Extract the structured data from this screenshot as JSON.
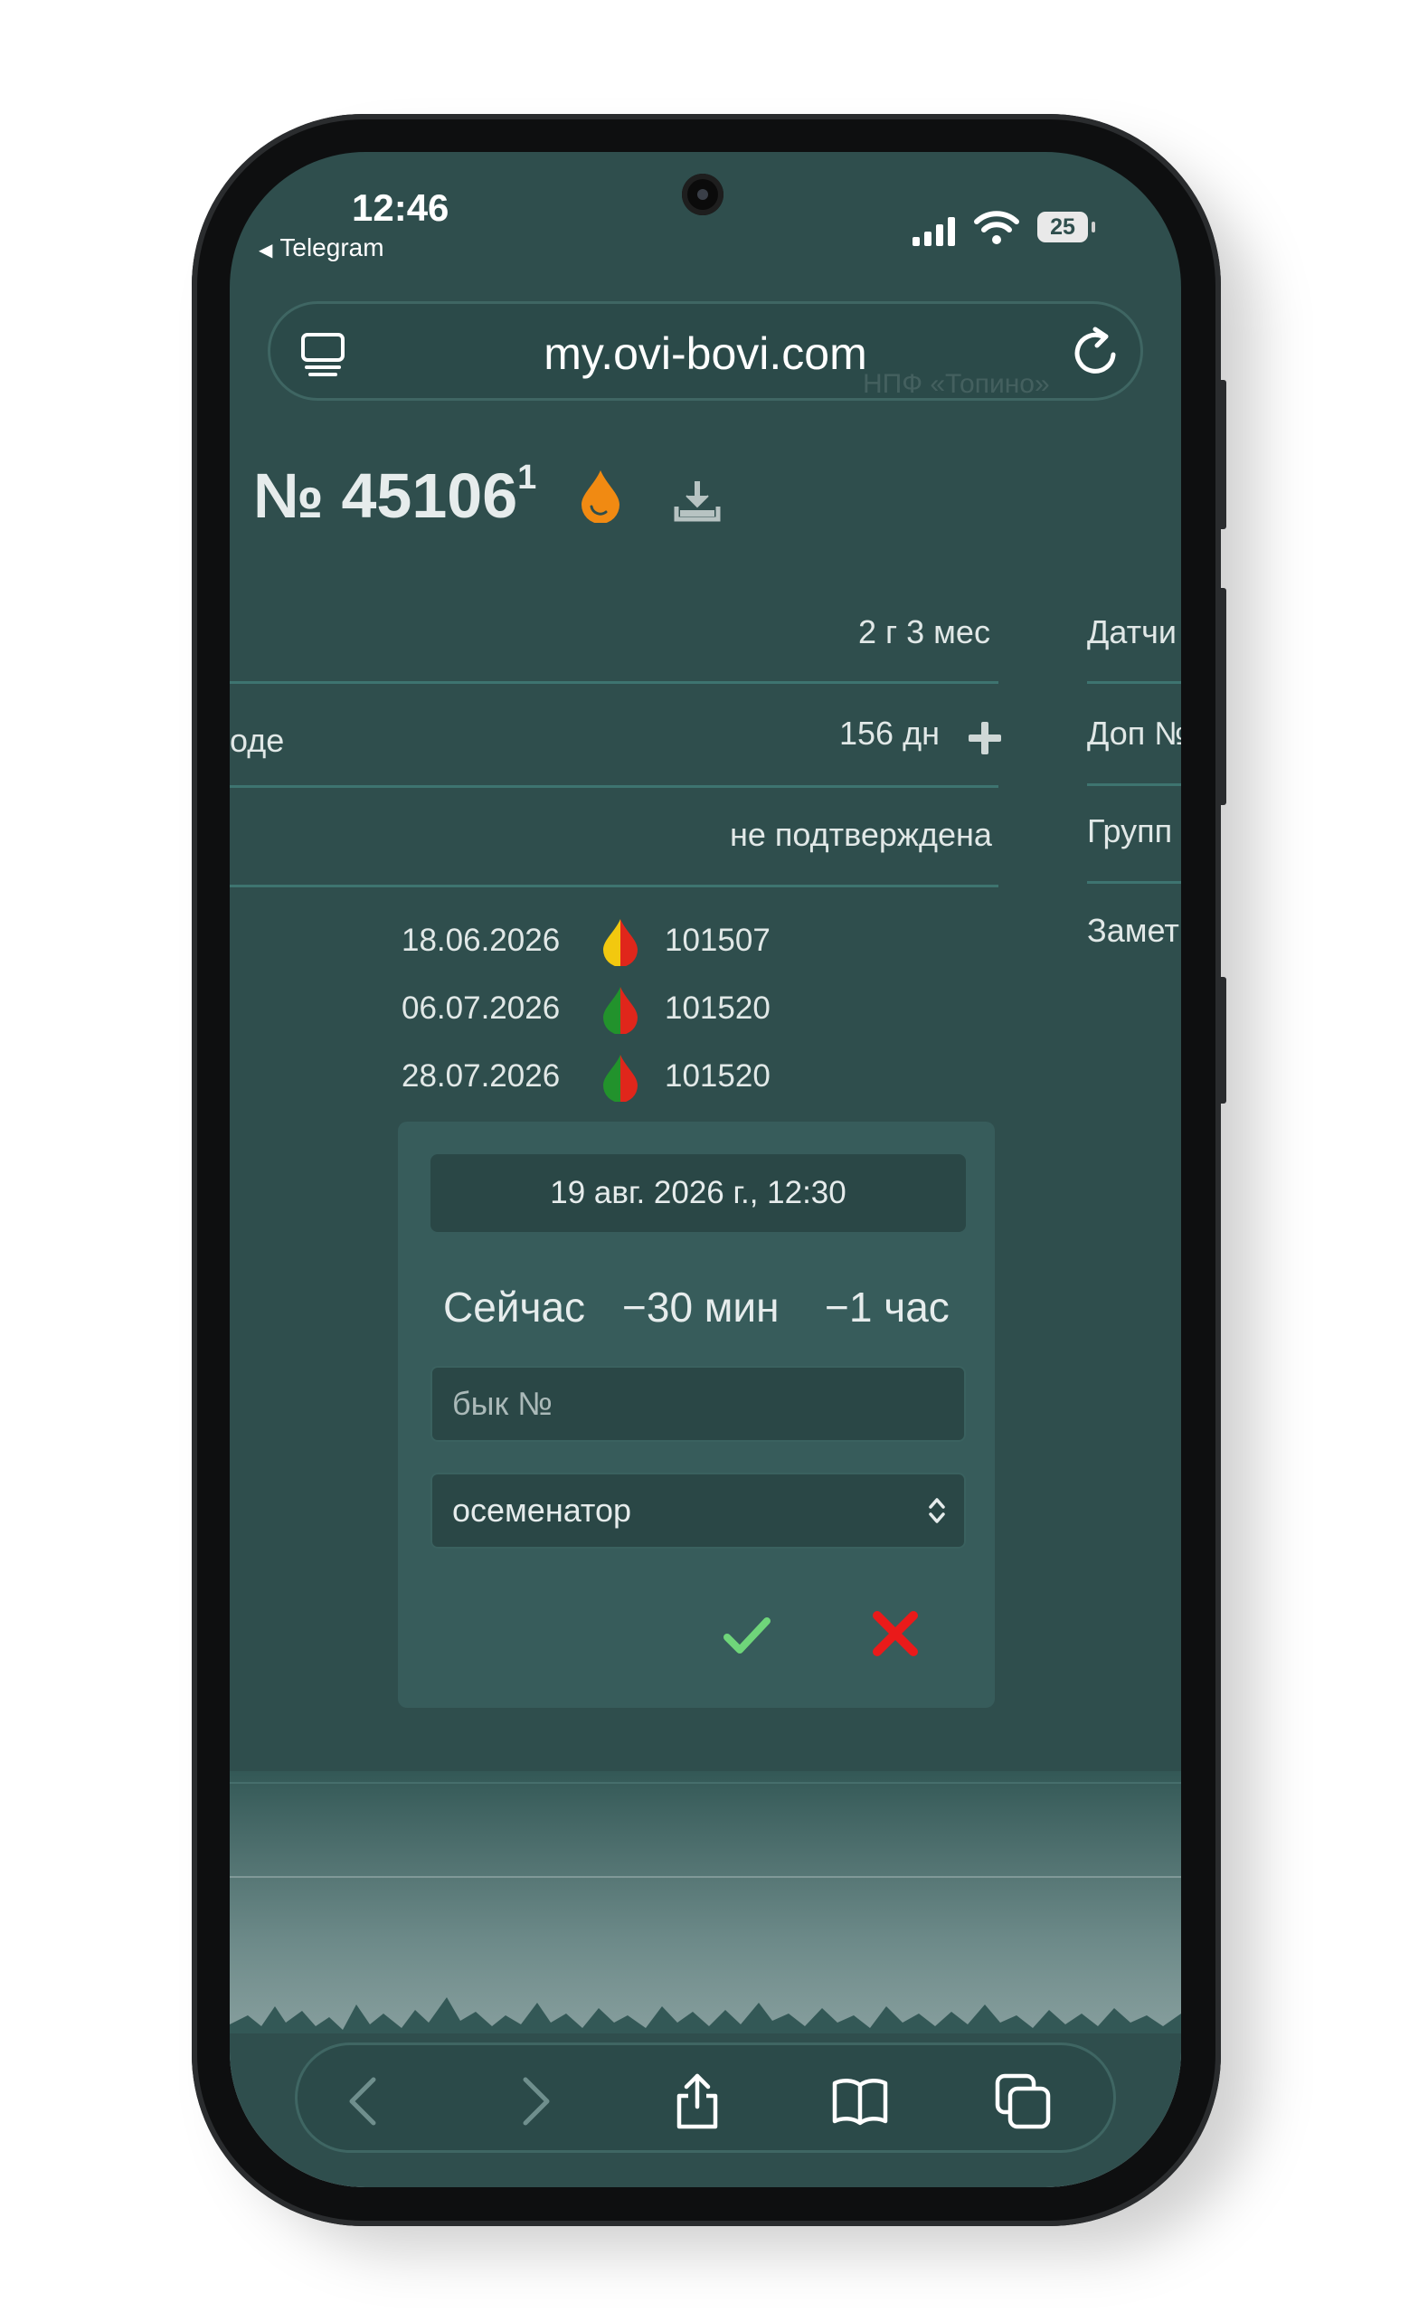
{
  "status": {
    "time": "12:46",
    "back_app": "Telegram",
    "battery": "25"
  },
  "browser": {
    "url": "my.ovi-bovi.com"
  },
  "ghost_text": "НПФ «Топино»",
  "animal": {
    "number": "№ 45106",
    "superscript": "1"
  },
  "info_rows": [
    {
      "left": "",
      "value": "2 г 3 мес"
    },
    {
      "left": "оде",
      "value": "156 дн"
    },
    {
      "left": "",
      "value": "не подтверждена"
    }
  ],
  "side_menu": [
    "Датчи",
    "Доп №",
    "Групп",
    "Замет"
  ],
  "history": [
    {
      "date": "18.06.2026",
      "bull": "101507",
      "drop_colors": [
        "#f2c80f",
        "#e0261b"
      ]
    },
    {
      "date": "06.07.2026",
      "bull": "101520",
      "drop_colors": [
        "#22922c",
        "#e0261b"
      ]
    },
    {
      "date": "28.07.2026",
      "bull": "101520",
      "drop_colors": [
        "#22922c",
        "#e0261b"
      ]
    }
  ],
  "form": {
    "datetime": "19 авг. 2026 г., 12:30",
    "quick": [
      "Сейчас",
      "−30 мин",
      "−1 час"
    ],
    "bull_placeholder": "бык №",
    "inseminator_value": "осеменатор"
  },
  "colors": {
    "background": "#2f4e4d",
    "panel": "#375c5b",
    "accent_ok": "#6fd57a",
    "accent_cancel": "#ea1a1a",
    "drop_orange": "#f18a12"
  },
  "icons": [
    "tabs-icon",
    "reload-icon",
    "drop-icon",
    "download-icon",
    "plus-icon",
    "check-icon",
    "close-icon",
    "back-icon",
    "forward-icon",
    "share-icon",
    "bookmarks-icon",
    "tabs-overview-icon"
  ]
}
